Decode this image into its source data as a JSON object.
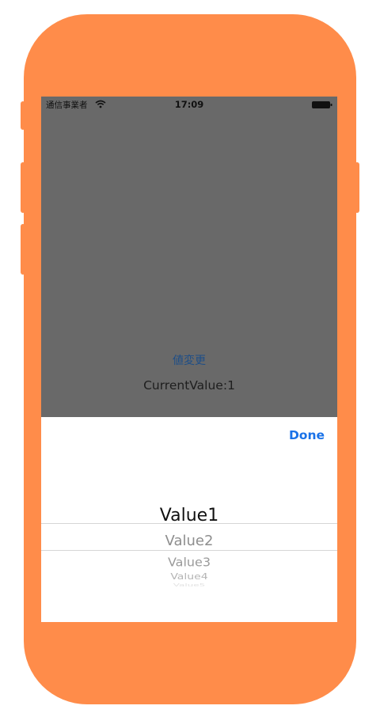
{
  "status_bar": {
    "carrier": "通信事業者",
    "time": "17:09"
  },
  "main": {
    "change_value_link": "値変更",
    "current_value_label": "CurrentValue:1"
  },
  "picker": {
    "done_label": "Done",
    "items": [
      "Value1",
      "Value2",
      "Value3",
      "Value4",
      "Value5"
    ],
    "selected_index": 0
  },
  "colors": {
    "device_body": "#FF8C4A",
    "dim_overlay": "#696969",
    "accent": "#1A72E8"
  }
}
